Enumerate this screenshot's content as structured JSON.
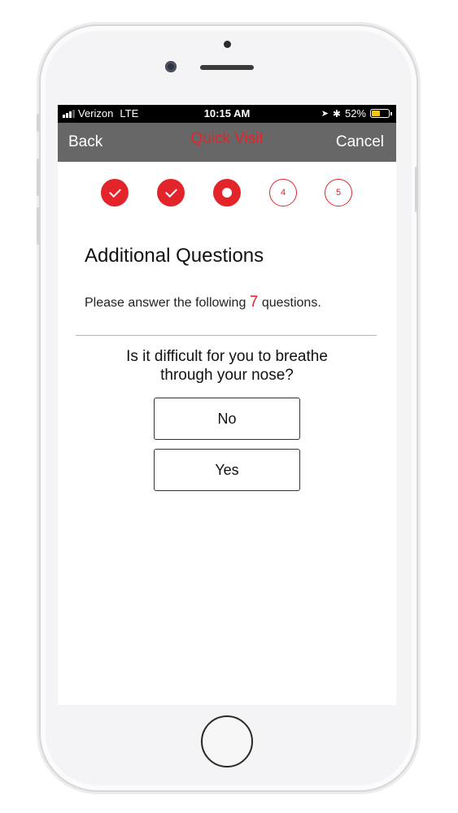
{
  "status_bar": {
    "carrier": "Verizon",
    "network": "LTE",
    "time": "10:15 AM",
    "battery_percent": "52%",
    "battery_level": 0.52,
    "battery_color": "#f5c518"
  },
  "nav": {
    "back_label": "Back",
    "title": "Quick Visit",
    "cancel_label": "Cancel"
  },
  "steps": [
    {
      "state": "done",
      "label": ""
    },
    {
      "state": "done",
      "label": ""
    },
    {
      "state": "current",
      "label": ""
    },
    {
      "state": "todo",
      "label": "4"
    },
    {
      "state": "todo",
      "label": "5"
    }
  ],
  "content": {
    "section_title": "Additional Questions",
    "instructions_prefix": "Please answer the following",
    "question_count": "7",
    "instructions_suffix": "questions.",
    "question_line1": "Is it difficult for you to breathe",
    "question_line2": "through your nose?",
    "answers": [
      "No",
      "Yes"
    ]
  },
  "colors": {
    "accent": "#e3242b",
    "nav_bar": "#676767"
  }
}
